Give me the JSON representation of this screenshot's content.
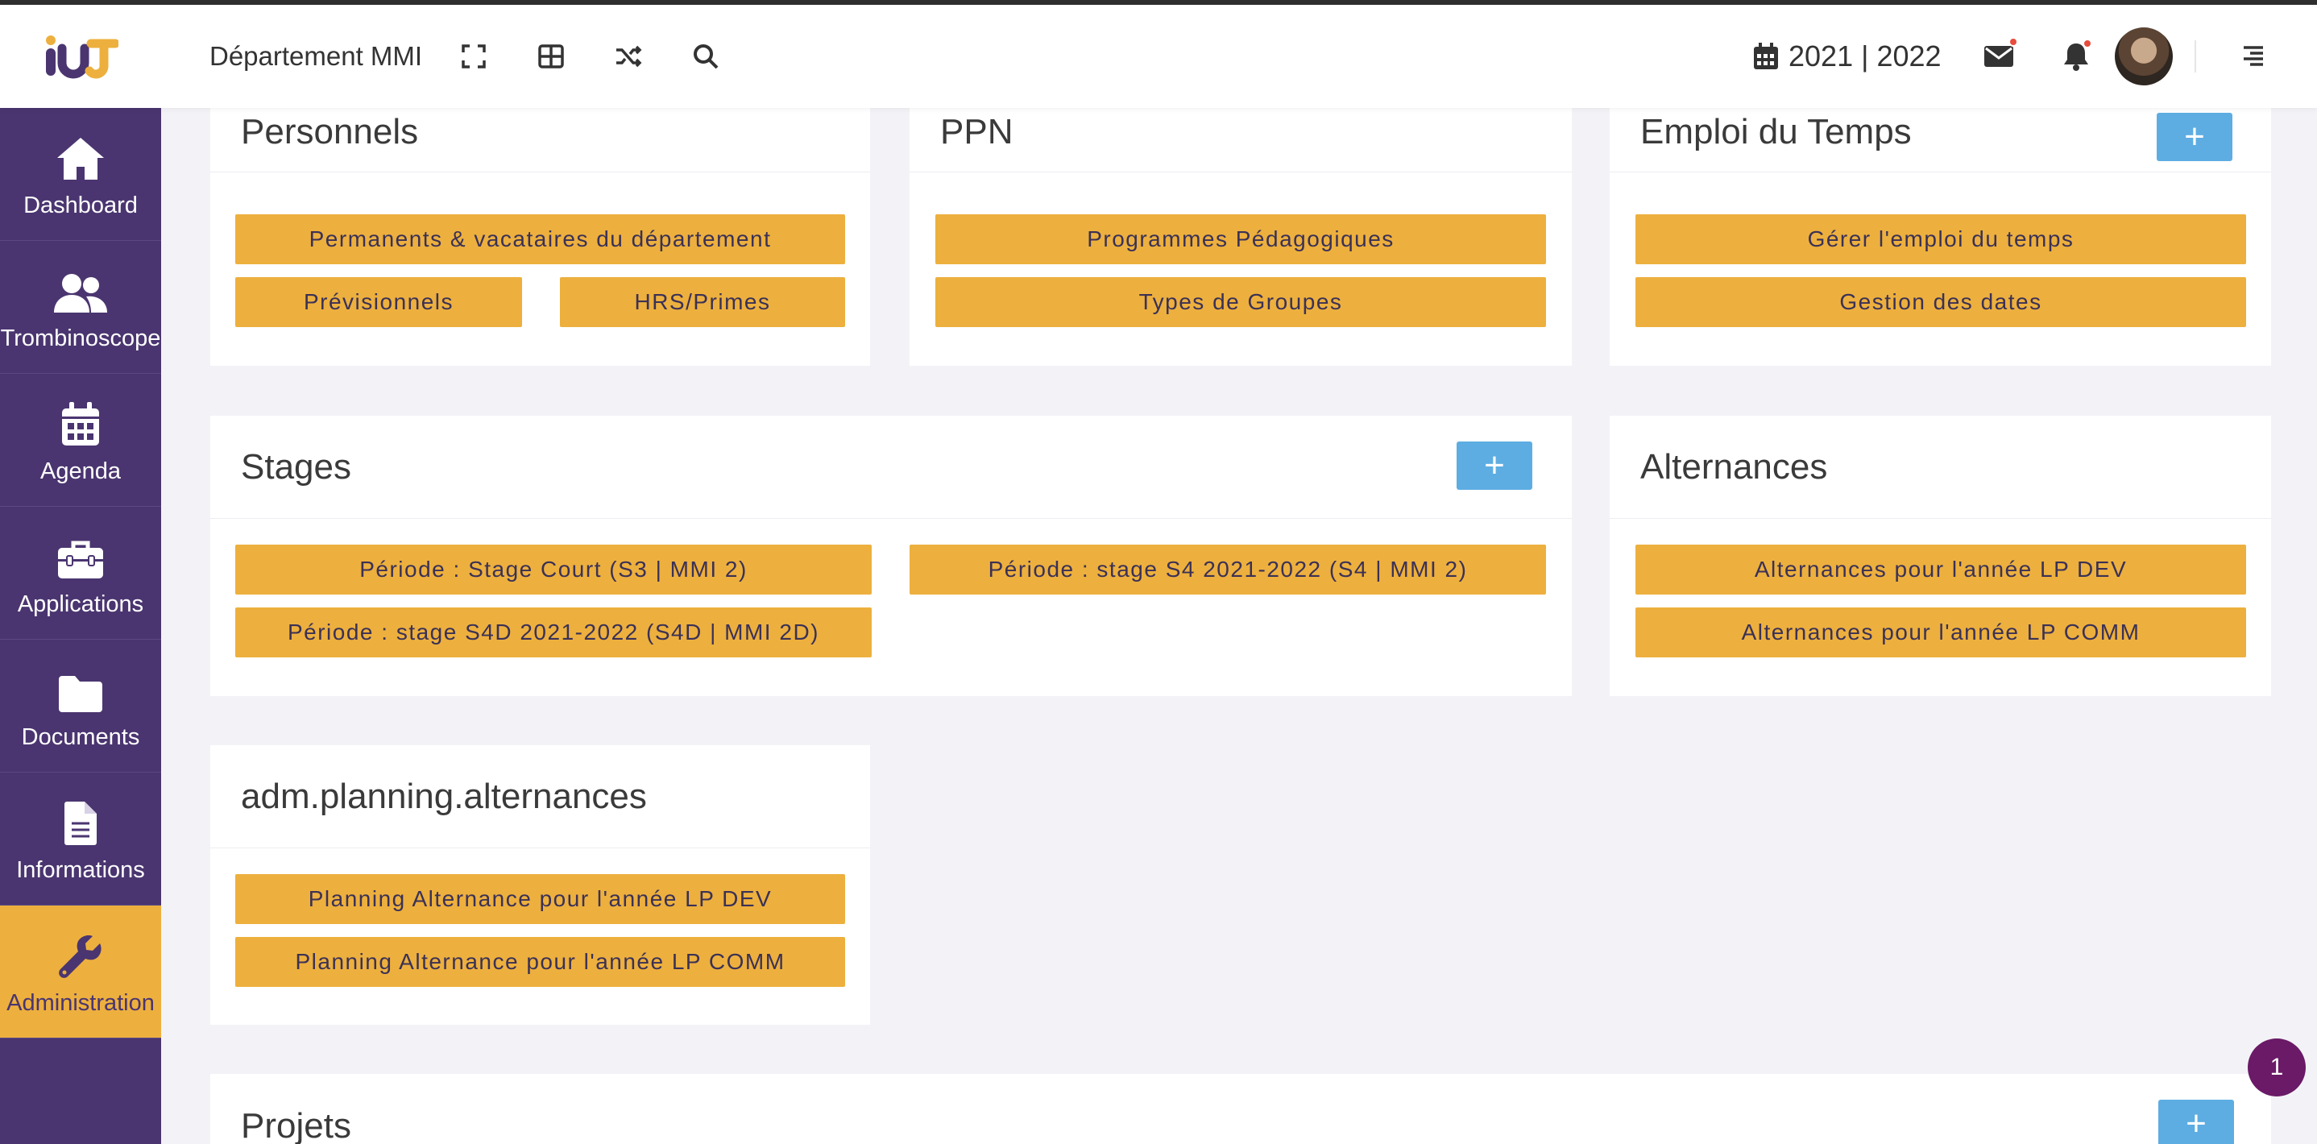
{
  "header": {
    "logo_label": "IUT",
    "department": "Département MMI",
    "year": "2021 | 2022",
    "icons": [
      "fullscreen-icon",
      "grid-icon",
      "shuffle-icon",
      "search-icon",
      "calendar-icon",
      "mail-icon",
      "bell-icon",
      "menu-icon"
    ]
  },
  "sidebar": {
    "items": [
      {
        "label": "Dashboard",
        "icon": "home-icon"
      },
      {
        "label": "Trombinoscope",
        "icon": "users-icon"
      },
      {
        "label": "Agenda",
        "icon": "calendar-icon"
      },
      {
        "label": "Applications",
        "icon": "toolbox-icon"
      },
      {
        "label": "Documents",
        "icon": "folder-icon"
      },
      {
        "label": "Informations",
        "icon": "document-icon"
      },
      {
        "label": "Administration",
        "icon": "wrench-icon"
      }
    ]
  },
  "cards": {
    "personnels": {
      "title": "Personnels",
      "buttons": [
        "Permanents & vacataires du département",
        "Prévisionnels",
        "HRS/Primes"
      ]
    },
    "ppn": {
      "title": "PPN",
      "buttons": [
        "Programmes Pédagogiques",
        "Types de Groupes"
      ]
    },
    "edt": {
      "title": "Emploi du Temps",
      "add": "+",
      "buttons": [
        "Gérer l'emploi du temps",
        "Gestion des dates"
      ]
    },
    "stages": {
      "title": "Stages",
      "add": "+",
      "buttons": [
        "Période : Stage Court (S3 | MMI 2)",
        "Période : stage S4 2021-2022 (S4 | MMI 2)",
        "Période : stage S4D 2021-2022 (S4D | MMI 2D)"
      ]
    },
    "alternances": {
      "title": "Alternances",
      "buttons": [
        "Alternances pour l'année LP DEV",
        "Alternances pour l'année LP COMM"
      ]
    },
    "planning": {
      "title": "adm.planning.alternances",
      "buttons": [
        "Planning Alternance pour l'année LP DEV",
        "Planning Alternance pour l'année LP COMM"
      ]
    },
    "projets": {
      "title": "Projets",
      "add": "+"
    }
  },
  "notification_badge": "1",
  "colors": {
    "sidebar": "#4a3570",
    "accent": "#edb03e",
    "add_button": "#5dade2",
    "background": "#f3f3f7"
  }
}
